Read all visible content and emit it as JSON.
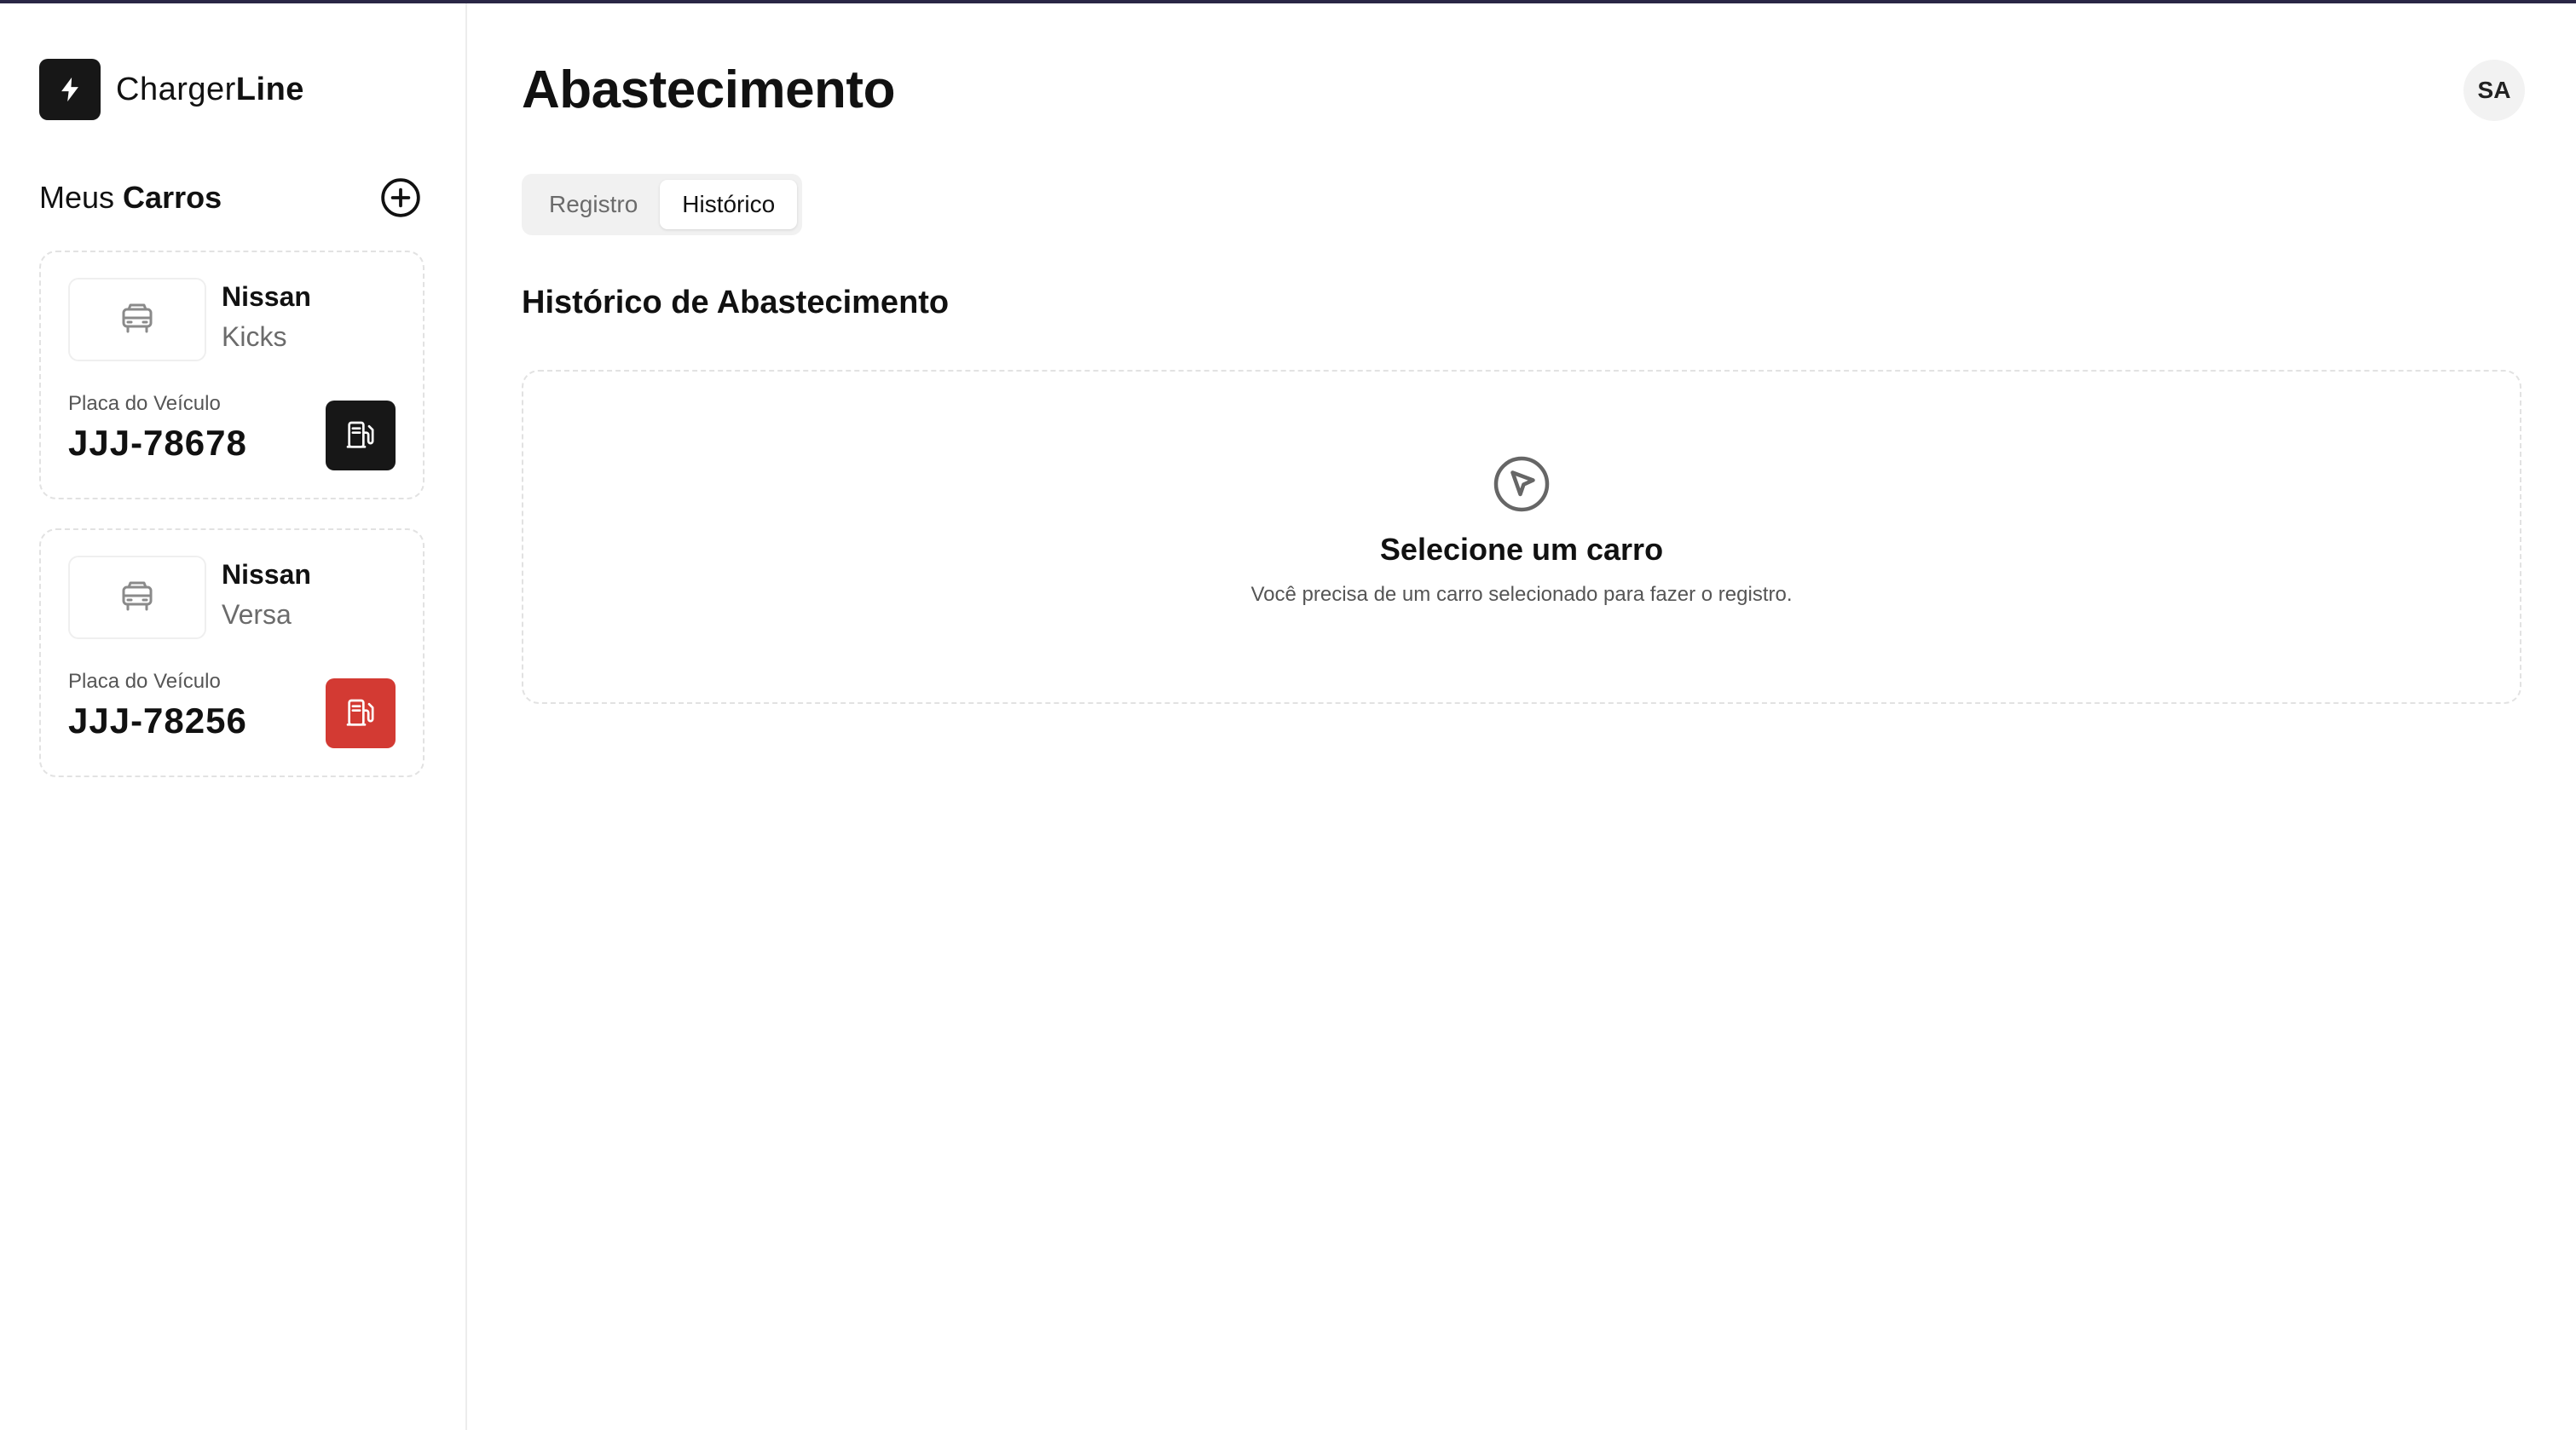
{
  "brand": {
    "name_light": "Charger",
    "name_bold": "Line"
  },
  "sidebar": {
    "title_light": "Meus ",
    "title_bold": "Carros",
    "cars": [
      {
        "make": "Nissan",
        "model": "Kicks",
        "plate_label": "Placa do Veículo",
        "plate": "JJJ-78678",
        "fuel_button_color": "#171717"
      },
      {
        "make": "Nissan",
        "model": "Versa",
        "plate_label": "Placa do Veículo",
        "plate": "JJJ-78256",
        "fuel_button_color": "#d33a33"
      }
    ]
  },
  "header": {
    "title": "Abastecimento",
    "avatar_initials": "SA"
  },
  "tabs": [
    {
      "label": "Registro",
      "active": false
    },
    {
      "label": "Histórico",
      "active": true
    }
  ],
  "history": {
    "title": "Histórico de Abastecimento",
    "empty_title": "Selecione um carro",
    "empty_description": "Você precisa de um carro selecionado para fazer o registro."
  },
  "icons": {
    "logo": "lightning-bolt-icon",
    "add": "plus-circle-icon",
    "car": "car-icon",
    "fuel": "fuel-pump-icon",
    "empty": "cursor-pointer-circle-icon"
  },
  "colors": {
    "accent_dark": "#171717",
    "accent_red": "#d33a33"
  }
}
